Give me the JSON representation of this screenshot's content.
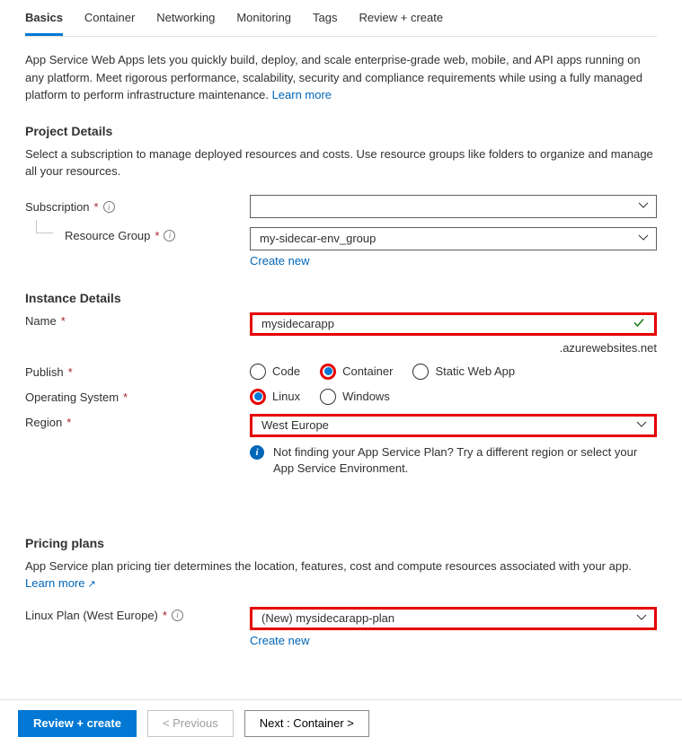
{
  "tabs": [
    "Basics",
    "Container",
    "Networking",
    "Monitoring",
    "Tags",
    "Review + create"
  ],
  "intro_text": "App Service Web Apps lets you quickly build, deploy, and scale enterprise-grade web, mobile, and API apps running on any platform. Meet rigorous performance, scalability, security and compliance requirements while using a fully managed platform to perform infrastructure maintenance.  ",
  "learn_more": "Learn more",
  "project": {
    "heading": "Project Details",
    "desc": "Select a subscription to manage deployed resources and costs. Use resource groups like folders to organize and manage all your resources.",
    "subscription_label": "Subscription",
    "subscription_value": "",
    "rg_label": "Resource Group",
    "rg_value": "my-sidecar-env_group",
    "create_new": "Create new"
  },
  "instance": {
    "heading": "Instance Details",
    "name_label": "Name",
    "name_value": "mysidecarapp",
    "domain_suffix": ".azurewebsites.net",
    "publish_label": "Publish",
    "publish_options": [
      "Code",
      "Container",
      "Static Web App"
    ],
    "os_label": "Operating System",
    "os_options": [
      "Linux",
      "Windows"
    ],
    "region_label": "Region",
    "region_value": "West Europe",
    "region_note": "Not finding your App Service Plan? Try a different region or select your App Service Environment."
  },
  "pricing": {
    "heading": "Pricing plans",
    "desc": "App Service plan pricing tier determines the location, features, cost and compute resources associated with your app. ",
    "learn_more": "Learn more",
    "plan_label": "Linux Plan (West Europe)",
    "plan_value": "(New) mysidecarapp-plan",
    "create_new": "Create new"
  },
  "footer": {
    "review": "Review + create",
    "previous": "< Previous",
    "next": "Next : Container >"
  }
}
